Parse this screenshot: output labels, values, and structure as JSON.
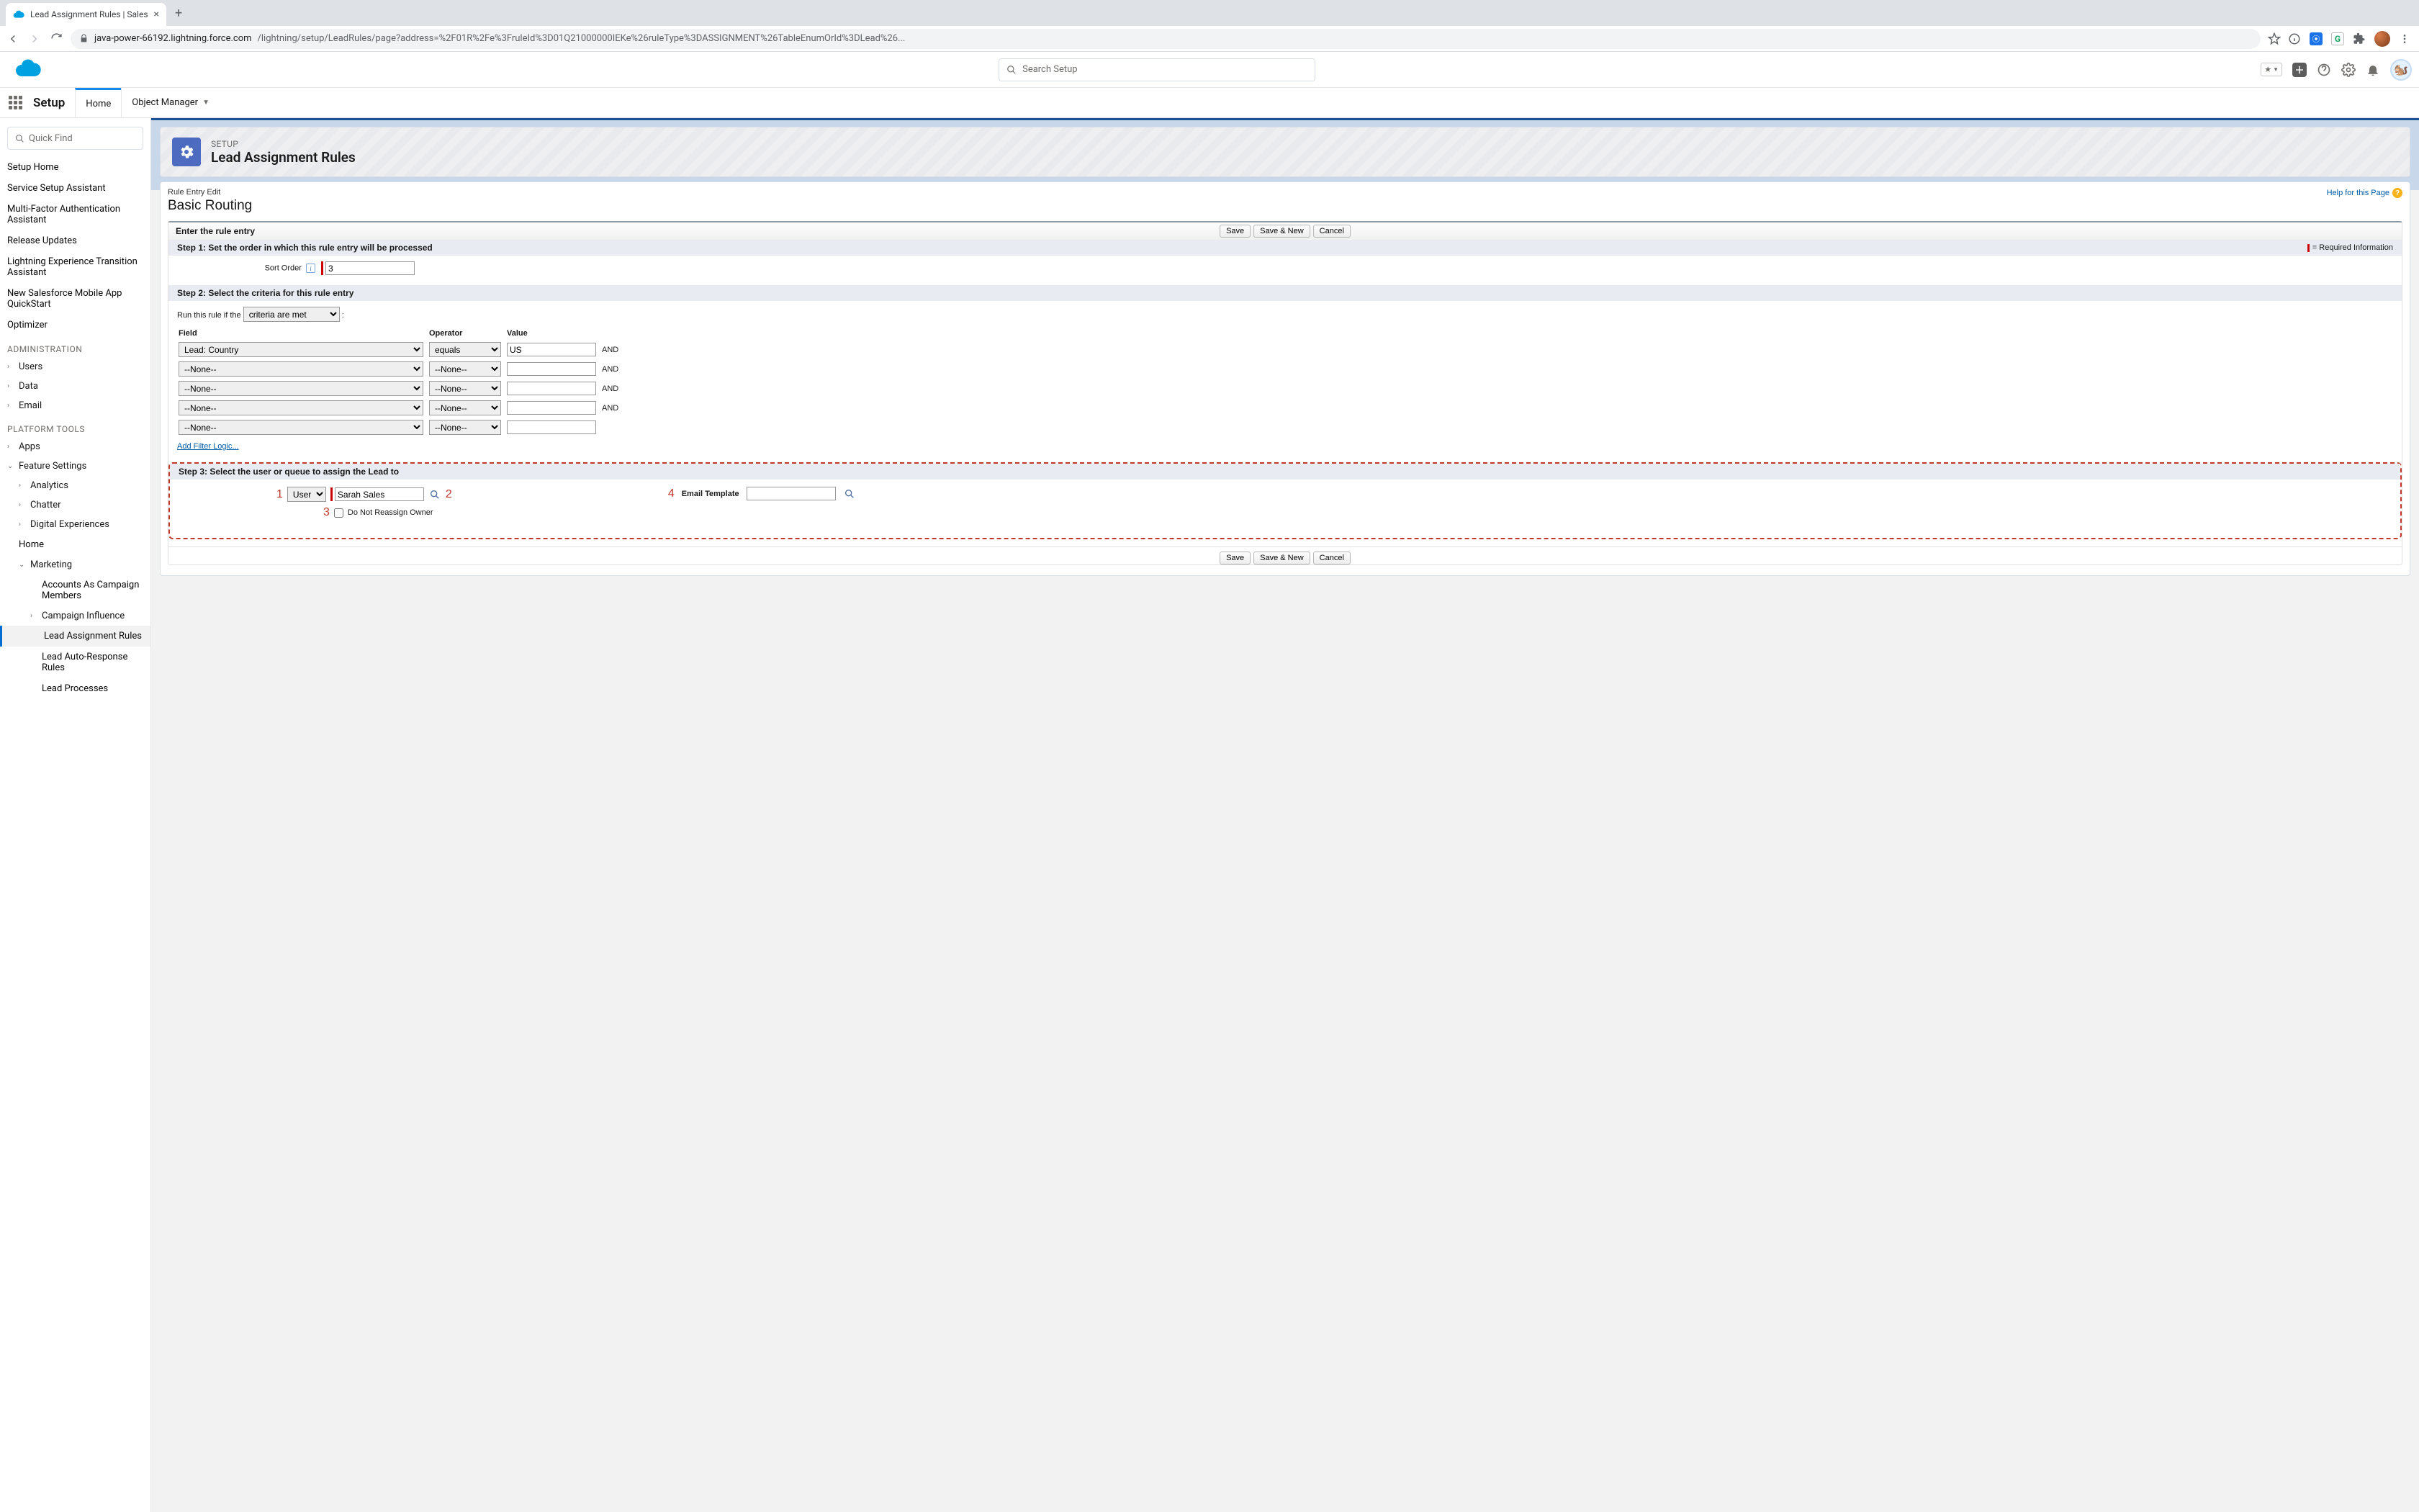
{
  "browser": {
    "tab_title": "Lead Assignment Rules | Sales",
    "url_host": "java-power-66192.lightning.force.com",
    "url_path": "/lightning/setup/LeadRules/page?address=%2F01R%2Fe%3FruleId%3D01Q21000000IEKe%26ruleType%3DASSIGNMENT%26TableEnumOrId%3DLead%26..."
  },
  "sf_header": {
    "search_placeholder": "Search Setup"
  },
  "app_nav": {
    "title": "Setup",
    "tabs": [
      "Home",
      "Object Manager"
    ]
  },
  "sidebar": {
    "quick_find": "Quick Find",
    "top_items": [
      "Setup Home",
      "Service Setup Assistant",
      "Multi-Factor Authentication Assistant",
      "Release Updates",
      "Lightning Experience Transition Assistant",
      "New Salesforce Mobile App QuickStart",
      "Optimizer"
    ],
    "admin_label": "ADMINISTRATION",
    "admin_items": [
      "Users",
      "Data",
      "Email"
    ],
    "platform_label": "PLATFORM TOOLS",
    "apps": "Apps",
    "feature_settings": "Feature Settings",
    "fs_children": [
      "Analytics",
      "Chatter",
      "Digital Experiences"
    ],
    "fs_home": "Home",
    "marketing": "Marketing",
    "marketing_children": [
      "Accounts As Campaign Members",
      "Campaign Influence",
      "Lead Assignment Rules",
      "Lead Auto-Response Rules",
      "Lead Processes"
    ]
  },
  "page_header": {
    "eyebrow": "SETUP",
    "title": "Lead Assignment Rules"
  },
  "content": {
    "small_title": "Rule Entry Edit",
    "title": "Basic Routing",
    "help": "Help for this Page",
    "entry_header": "Enter the rule entry",
    "buttons": {
      "save": "Save",
      "save_new": "Save & New",
      "cancel": "Cancel"
    },
    "required_info": "= Required Information",
    "step1": {
      "title": "Step 1: Set the order in which this rule entry will be processed",
      "sort_label": "Sort Order",
      "sort_value": "3"
    },
    "step2": {
      "title": "Step 2: Select the criteria for this rule entry",
      "run_label": "Run this rule if the",
      "run_select": "criteria are met",
      "col_field": "Field",
      "col_op": "Operator",
      "col_val": "Value",
      "and": "AND",
      "rows": [
        {
          "field": "Lead: Country",
          "op": "equals",
          "val": "US"
        },
        {
          "field": "--None--",
          "op": "--None--",
          "val": ""
        },
        {
          "field": "--None--",
          "op": "--None--",
          "val": ""
        },
        {
          "field": "--None--",
          "op": "--None--",
          "val": ""
        },
        {
          "field": "--None--",
          "op": "--None--",
          "val": ""
        }
      ],
      "filter_link": "Add Filter Logic..."
    },
    "step3": {
      "title": "Step 3: Select the user or queue to assign the Lead to",
      "type_select": "User",
      "user_value": "Sarah Sales",
      "checkbox_label": "Do Not Reassign Owner",
      "email_label": "Email Template",
      "callouts": {
        "c1": "1",
        "c2": "2",
        "c3": "3",
        "c4": "4"
      }
    }
  }
}
